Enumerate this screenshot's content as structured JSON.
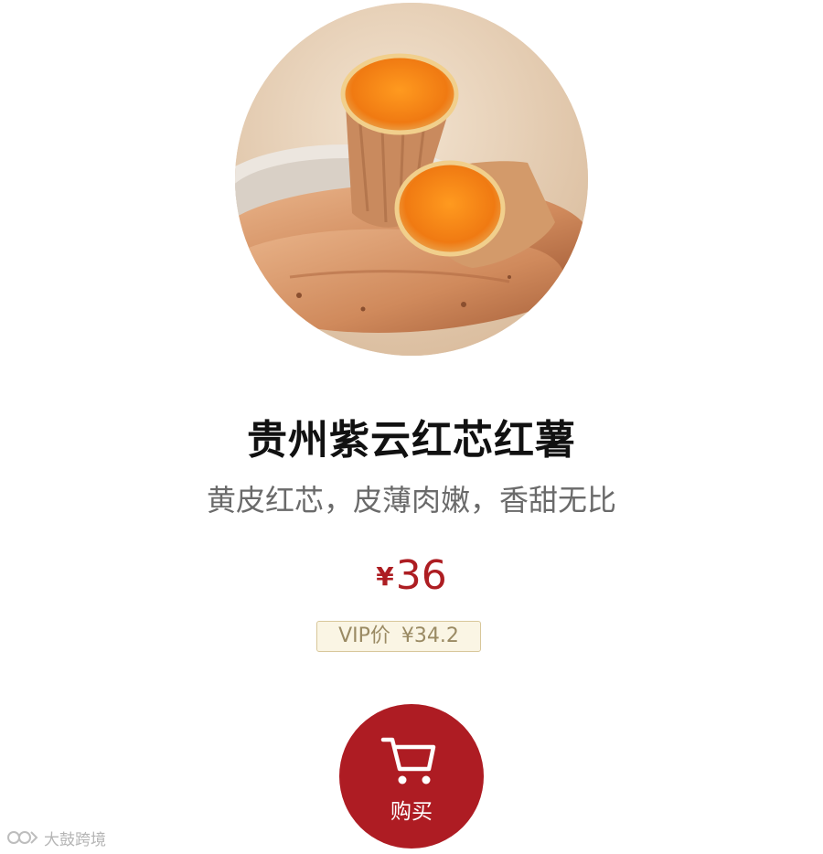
{
  "product": {
    "image": "product-photo-sweet-potato",
    "title": "贵州紫云红芯红薯",
    "subtitle": "黄皮红芯，皮薄肉嫩，香甜无比",
    "price": {
      "currency": "¥",
      "value": "36"
    },
    "vip": {
      "label": "VIP价",
      "price": "¥34.2"
    }
  },
  "buy_button": {
    "icon": "shopping-cart-icon",
    "label": "购买"
  },
  "watermark": {
    "icon": "brand-logo-icon",
    "text": "大鼓跨境"
  },
  "colors": {
    "accent": "#ae1c23",
    "price": "#ad1d22",
    "vip_border": "#d8c79a",
    "vip_text": "#9a8a63",
    "subtitle": "#6a6a6a"
  }
}
